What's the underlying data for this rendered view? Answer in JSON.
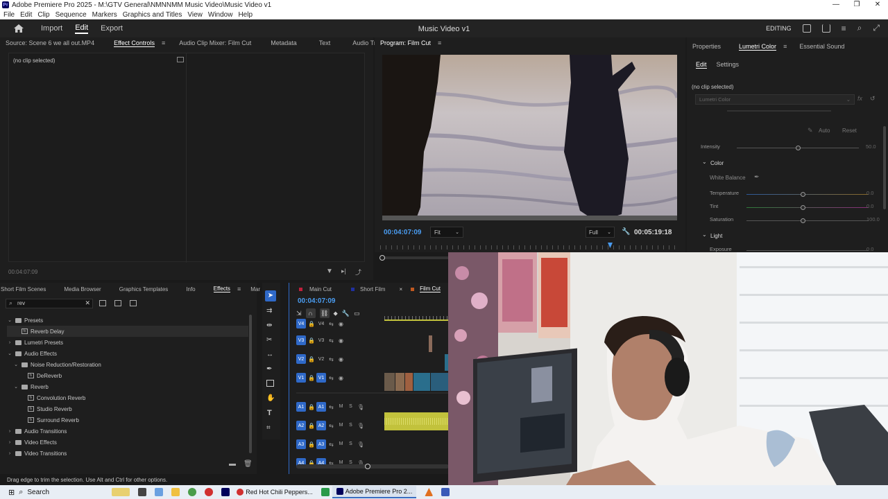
{
  "window": {
    "title": "Adobe Premiere Pro 2025 - M:\\GTV General\\NMNNMM Music Video\\Music Video v1",
    "logo_text": "Pr"
  },
  "menu": [
    "File",
    "Edit",
    "Clip",
    "Sequence",
    "Markers",
    "Graphics and Titles",
    "View",
    "Window",
    "Help"
  ],
  "header": {
    "nav": [
      "Import",
      "Edit",
      "Export"
    ],
    "project_title": "Music Video v1",
    "workspace": "EDITING"
  },
  "source_panel": {
    "tabs": [
      "Source: Scene 6 we all out.MP4",
      "Effect Controls",
      "Audio Clip Mixer: Film Cut",
      "Metadata",
      "Text",
      "Audio Track Mixer: Film Cut"
    ],
    "status": "(no clip selected)",
    "timecode": "00:04:07:09"
  },
  "program_monitor": {
    "title": "Program: Film Cut",
    "timecode": "00:04:07:09",
    "fit": "Fit",
    "quality": "Full",
    "duration": "00:05:19:18"
  },
  "lumetri": {
    "tabs": [
      "Properties",
      "Lumetri Color",
      "Essential Sound"
    ],
    "subtabs": [
      "Edit",
      "Settings"
    ],
    "status": "(no clip selected)",
    "dropdown": "Lumetri Color",
    "auto": "Auto",
    "reset": "Reset",
    "intensity_label": "Intensity",
    "intensity_value": "50.0",
    "color_section": "Color",
    "white_balance": "White Balance",
    "sliders": [
      {
        "label": "Temperature",
        "value": "0.0"
      },
      {
        "label": "Tint",
        "value": "0.0"
      },
      {
        "label": "Saturation",
        "value": "100.0"
      }
    ],
    "light_section": "Light",
    "exposure_label": "Exposure",
    "exposure_value": "0.0"
  },
  "effects_panel": {
    "tabs": [
      "Short Film Scenes",
      "Media Browser",
      "Graphics Templates",
      "Info",
      "Effects",
      "Mar"
    ],
    "search_value": "rev",
    "tree": [
      {
        "label": "Presets",
        "kind": "folder",
        "depth": 0,
        "open": true
      },
      {
        "label": "Reverb Delay",
        "kind": "fx",
        "depth": 1,
        "selected": true
      },
      {
        "label": "Lumetri Presets",
        "kind": "folder",
        "depth": 0,
        "open": false
      },
      {
        "label": "Audio Effects",
        "kind": "folder",
        "depth": 0,
        "open": true
      },
      {
        "label": "Noise Reduction/Restoration",
        "kind": "folder",
        "depth": 1,
        "open": true
      },
      {
        "label": "DeReverb",
        "kind": "fx",
        "depth": 2
      },
      {
        "label": "Reverb",
        "kind": "folder",
        "depth": 1,
        "open": true
      },
      {
        "label": "Convolution Reverb",
        "kind": "fx",
        "depth": 2
      },
      {
        "label": "Studio Reverb",
        "kind": "fx",
        "depth": 2
      },
      {
        "label": "Surround Reverb",
        "kind": "fx",
        "depth": 2
      },
      {
        "label": "Audio Transitions",
        "kind": "folder",
        "depth": 0,
        "open": false
      },
      {
        "label": "Video Effects",
        "kind": "folder",
        "depth": 0,
        "open": false
      },
      {
        "label": "Video Transitions",
        "kind": "folder",
        "depth": 0,
        "open": false
      }
    ]
  },
  "timeline": {
    "tabs": [
      "Main Cut",
      "Short Film",
      "Film Cut"
    ],
    "timecode": "00:04:07:09",
    "video_tracks": [
      {
        "src": "V4",
        "name": "V4"
      },
      {
        "src": "V3",
        "name": "V3"
      },
      {
        "src": "V2",
        "name": "V2"
      },
      {
        "src": "V1",
        "name": "V1"
      }
    ],
    "audio_tracks": [
      {
        "src": "A1",
        "name": "A1"
      },
      {
        "src": "A2",
        "name": "A2"
      },
      {
        "src": "A3",
        "name": "A3"
      },
      {
        "src": "A4",
        "name": "A4"
      }
    ],
    "mute_label": "M",
    "solo_label": "S"
  },
  "statusbar": "Drag edge to trim the selection. Use Alt and Ctrl for other options.",
  "taskbar": {
    "search": "Search",
    "apps": [
      "Red Hot Chili Peppers...",
      "Adobe Premiere Pro 2..."
    ]
  },
  "colors": {
    "accent_blue": "#2f69c8",
    "timecode_blue": "#4a9cf0",
    "audio_clip": "#c2c23c",
    "video_clip": "#2a6e8c"
  }
}
